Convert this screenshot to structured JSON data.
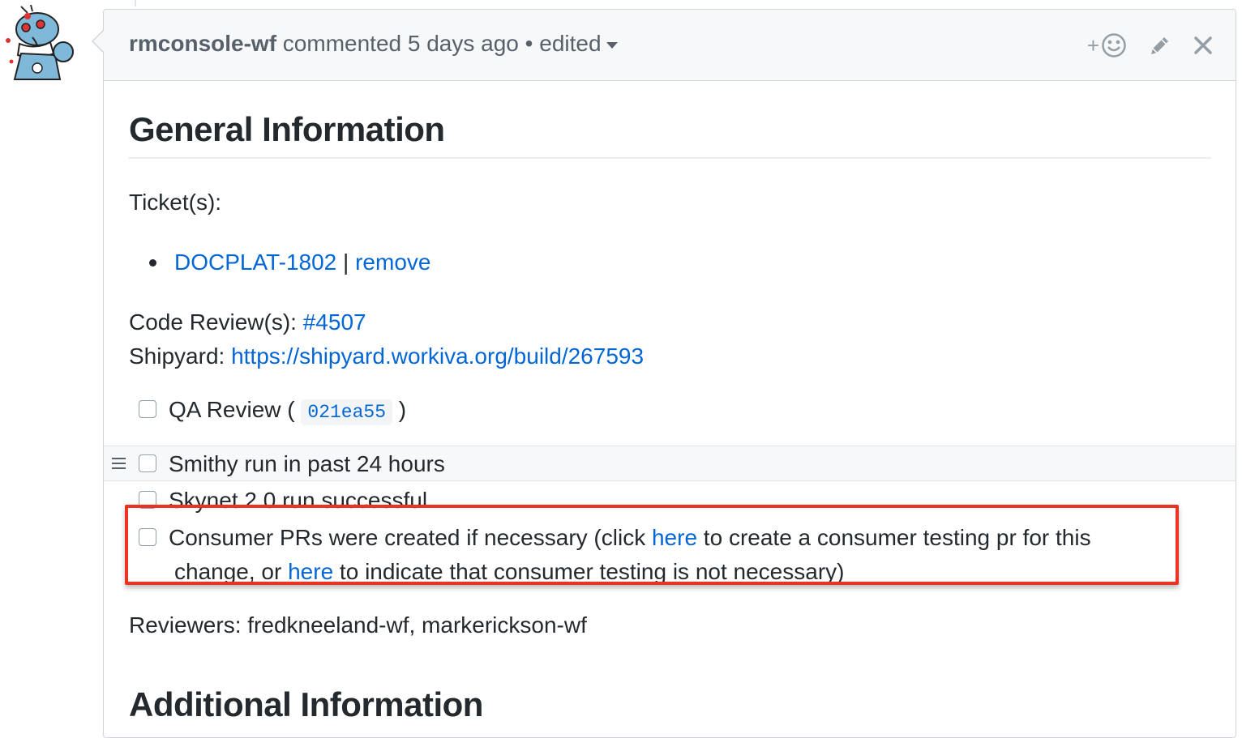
{
  "comment": {
    "author": "rmconsole-wf",
    "action": " commented 5 days ago ",
    "separator": "•",
    "edited_label": " edited",
    "actions": {
      "reaction_label": "+",
      "edit_icon": "pencil-icon",
      "close_icon": "close-icon",
      "reaction_icon": "smiley-icon"
    }
  },
  "body": {
    "general_heading": "General Information",
    "tickets_label": "Ticket(s):",
    "ticket_link": "DOCPLAT-1802",
    "ticket_separator": " | ",
    "ticket_remove": "remove",
    "code_review_label": "Code Review(s): ",
    "code_review_link": "#4507",
    "shipyard_label": "Shipyard: ",
    "shipyard_link": "https://shipyard.workiva.org/build/267593",
    "tasks": [
      {
        "prefix": "QA Review ( ",
        "code": "021ea55",
        "suffix": " )",
        "checked": false
      },
      {
        "text": "Smithy run in past 24 hours",
        "checked": false
      },
      {
        "text": "Skynet 2.0 run successful",
        "checked": false
      },
      {
        "text_1": "Consumer PRs were created if necessary (click ",
        "link_1": "here",
        "text_2": " to create a consumer testing pr for this",
        "text_3": "change, or ",
        "link_2": "here",
        "text_4": " to indicate that consumer testing is not necessary)",
        "checked": false
      }
    ],
    "reviewers": "Reviewers: fredkneeland-wf, markerickson-wf",
    "additional_heading": "Additional Information"
  },
  "colors": {
    "link": "#0366d6",
    "highlight_border": "#ea3323",
    "header_bg": "#f6f8fa"
  }
}
